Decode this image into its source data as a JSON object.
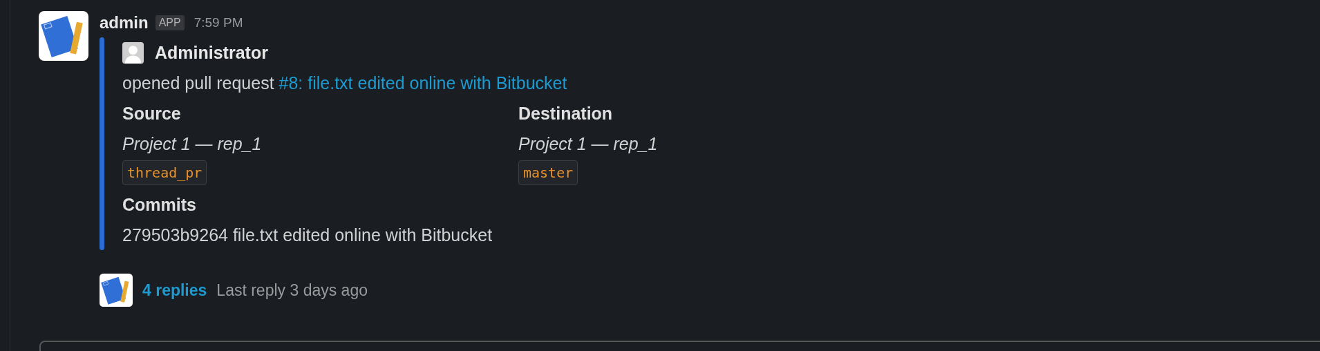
{
  "message": {
    "sender": "admin",
    "badge": "APP",
    "time": "7:59 PM",
    "attachment": {
      "author": "Administrator",
      "text": "opened pull request ",
      "link": "#8: file.txt edited online with Bitbucket",
      "fields": [
        {
          "title": "Source",
          "value": "Project 1 — rep_1",
          "branch": "thread_pr"
        },
        {
          "title": "Destination",
          "value": "Project 1 — rep_1",
          "branch": "master"
        }
      ],
      "commits_title": "Commits",
      "commit": "279503b9264 file.txt edited online with Bitbucket"
    },
    "thread": {
      "replies": "4 replies",
      "last_reply": "Last reply 3 days ago"
    }
  }
}
